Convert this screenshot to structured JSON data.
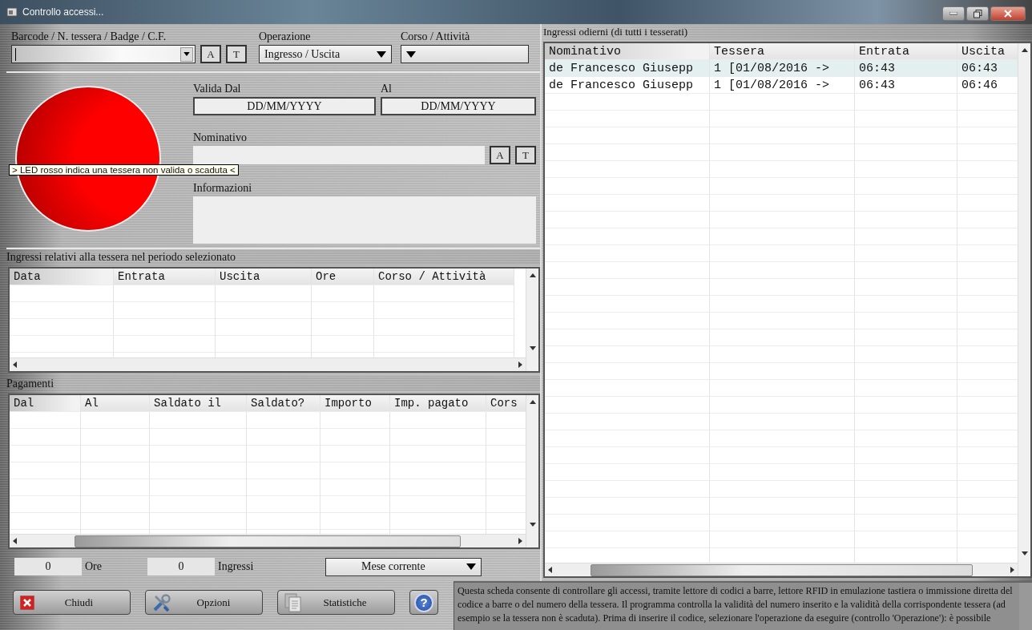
{
  "window": {
    "title": "Controllo accessi..."
  },
  "lookup": {
    "label": "Barcode / N. tessera / Badge / C.F.",
    "buttons": [
      "A",
      "T"
    ]
  },
  "operation": {
    "label": "Operazione",
    "value": "Ingresso / Uscita"
  },
  "course": {
    "label": "Corso / Attività"
  },
  "led": {
    "lit": true,
    "tooltip": "> LED rosso indica una tessera non valida o scaduta <"
  },
  "valid_from": {
    "label": "Valida Dal",
    "value": "DD/MM/YYYY"
  },
  "valid_to": {
    "label": "Al",
    "value": "DD/MM/YYYY"
  },
  "name": {
    "label": "Nominativo",
    "buttons": [
      "A",
      "T"
    ]
  },
  "info": {
    "label": "Informazioni"
  },
  "entries": {
    "title": "Ingressi relativi alla tessera nel periodo selezionato",
    "columns": [
      "Data",
      "Entrata",
      "Uscita",
      "Ore",
      "Corso / Attività"
    ]
  },
  "payments": {
    "title": "Pagamenti",
    "columns": [
      "Dal",
      "Al",
      "Saldato il",
      "Saldato?",
      "Importo",
      "Imp. pagato",
      "Cors"
    ]
  },
  "totals": {
    "hours_value": "0",
    "hours_label": "Ore",
    "entries_value": "0",
    "entries_label": "Ingressi",
    "period": "Mese corrente"
  },
  "buttons": [
    {
      "kind": "close",
      "label": "Chiudi"
    },
    {
      "kind": "options",
      "label": "Opzioni"
    },
    {
      "kind": "stats",
      "label": "Statistiche"
    },
    {
      "kind": "help",
      "label": "?"
    }
  ],
  "today": {
    "title": "Ingressi odierni (di tutti i tesserati)",
    "columns": [
      "Nominativo",
      "Tessera",
      "Entrata",
      "Uscita"
    ],
    "rows": [
      {
        "selected": true,
        "cells": [
          "de Francesco Giusepp",
          "1 [01/08/2016 ->",
          "06:43",
          "06:43"
        ]
      },
      {
        "selected": false,
        "cells": [
          "de Francesco Giusepp",
          "1 [01/08/2016 ->",
          "06:43",
          "06:46"
        ]
      }
    ]
  },
  "description": "Questa scheda consente di controllare gli accessi, tramite lettore di codici a barre, lettore RFID in emulazione tastiera o immissione diretta del codice a barre o del numero della tessera. Il programma controlla la validità del numero inserito e la validità della corrispondente tessera (ad esempio se la tessera non è scaduta). Prima di inserire il codice, selezionare l'operazione da eseguire (controllo 'Operazione'): è possibile"
}
